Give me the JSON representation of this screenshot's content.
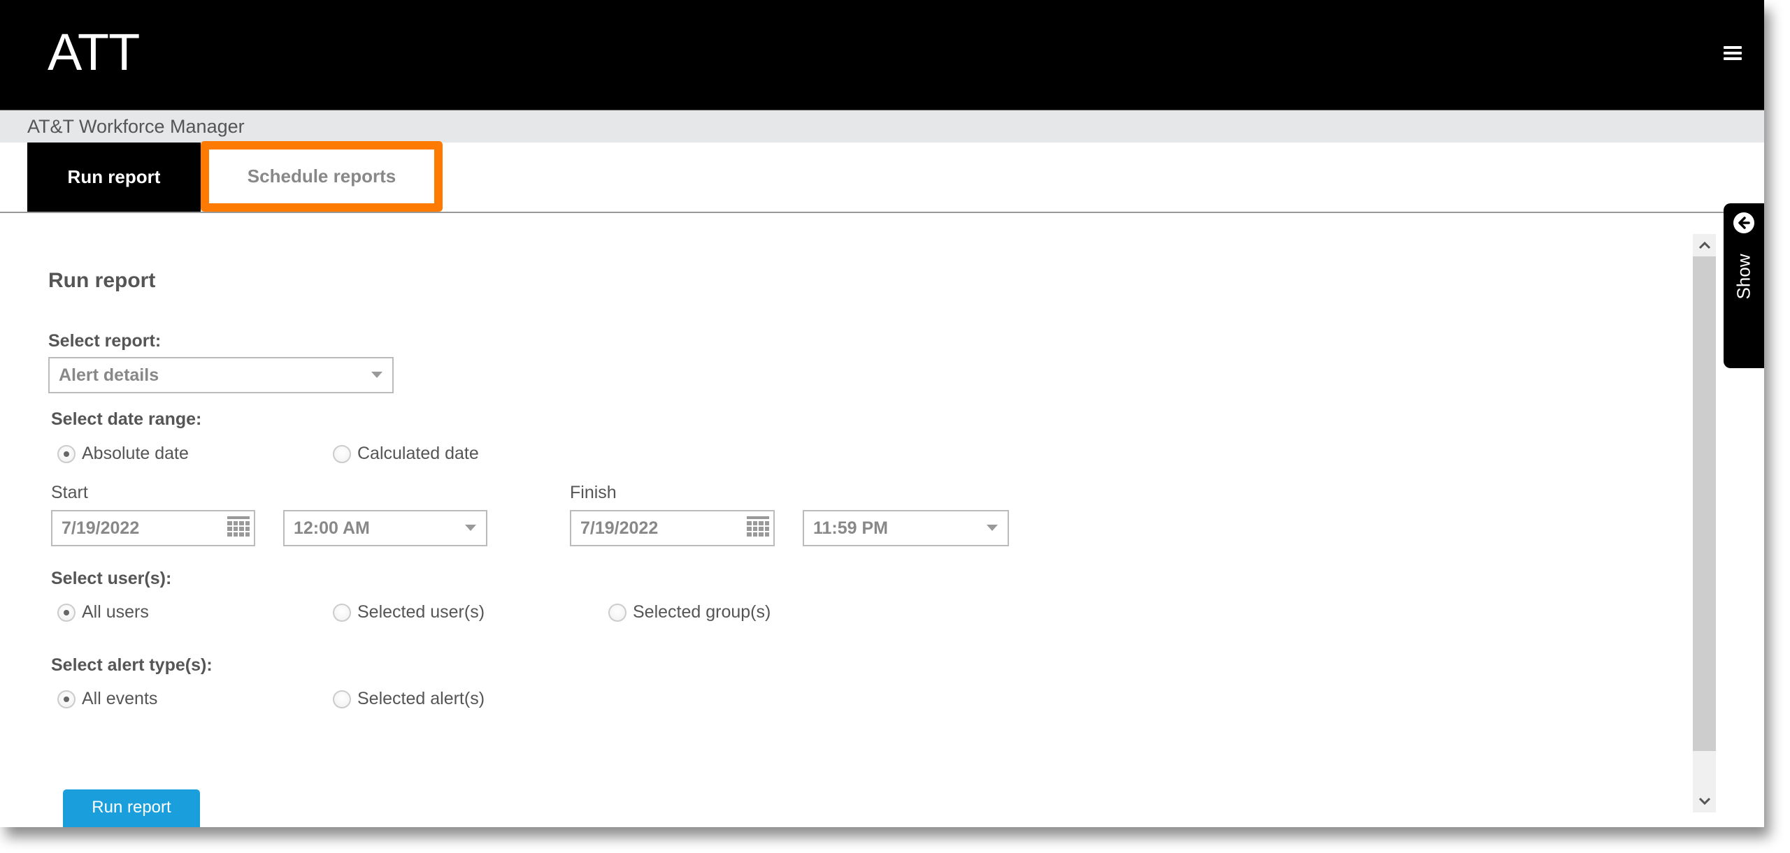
{
  "header": {
    "brand": "ATT",
    "menu_icon": "hamburger-menu-icon"
  },
  "subheader": {
    "title": "AT&T Workforce Manager"
  },
  "tabs": [
    {
      "label": "Run report",
      "active": true
    },
    {
      "label": "Schedule reports",
      "active": false,
      "highlighted": true
    }
  ],
  "colors": {
    "highlight": "#ff7a00",
    "primary_button": "#1a9fdc",
    "header_bg": "#000000",
    "subheader_bg": "#e6e7e8"
  },
  "form": {
    "heading": "Run report",
    "select_report": {
      "label": "Select report:",
      "value": "Alert details"
    },
    "date_range": {
      "label": "Select date range:",
      "options": [
        {
          "label": "Absolute date",
          "checked": true
        },
        {
          "label": "Calculated date",
          "checked": false
        }
      ]
    },
    "start": {
      "label": "Start",
      "date": "7/19/2022",
      "time": "12:00 AM"
    },
    "finish": {
      "label": "Finish",
      "date": "7/19/2022",
      "time": "11:59 PM"
    },
    "users": {
      "label": "Select user(s):",
      "options": [
        {
          "label": "All users",
          "checked": true
        },
        {
          "label": "Selected user(s)",
          "checked": false
        },
        {
          "label": "Selected group(s)",
          "checked": false
        }
      ]
    },
    "alert_types": {
      "label": "Select alert type(s):",
      "options": [
        {
          "label": "All events",
          "checked": true
        },
        {
          "label": "Selected alert(s)",
          "checked": false
        }
      ]
    },
    "submit_label": "Run report"
  },
  "side_panel": {
    "label": "Show",
    "icon": "arrow-left-circle-icon"
  },
  "scrollbar": {
    "up_icon": "chevron-up-icon",
    "down_icon": "chevron-down-icon"
  }
}
